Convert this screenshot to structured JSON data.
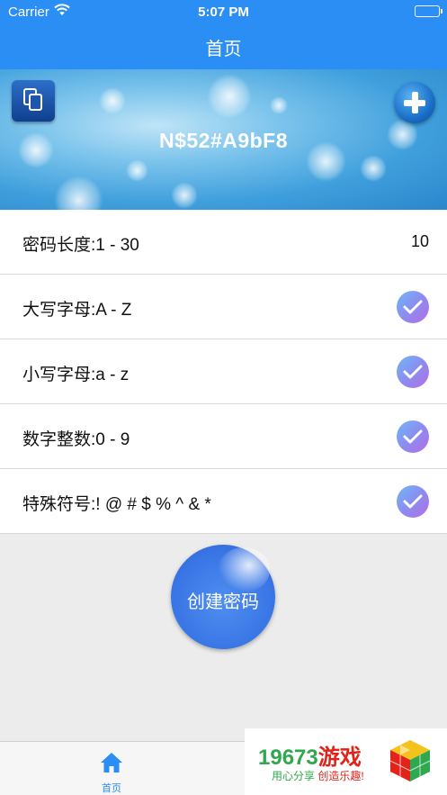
{
  "status_bar": {
    "carrier": "Carrier",
    "time": "5:07 PM"
  },
  "nav": {
    "title": "首页"
  },
  "banner": {
    "password": "N$52#A9bF8"
  },
  "settings": {
    "length_label": "密码长度:1 - 30",
    "length_value": "10",
    "uppercase_label": "大写字母:A - Z",
    "lowercase_label": "小写字母:a - z",
    "digits_label": "数字整数:0 - 9",
    "symbols_label": "特殊符号:! @ # $ % ^ & *"
  },
  "actions": {
    "create_label": "创建密码"
  },
  "tabbar": {
    "home_label": "首页"
  },
  "ad": {
    "brand_num": "19673",
    "brand_cn": "游戏",
    "slogan_a": "用心分享",
    "slogan_b": "创造乐趣!"
  },
  "colors": {
    "primary": "#2a8ef5",
    "check_gradient_start": "#6fb9f5",
    "check_gradient_end": "#b26fe6",
    "create_button": "#3a77e6"
  },
  "icons": {
    "copy": "copy-icon",
    "add": "plus-icon",
    "check": "checkmark-icon",
    "home": "home-icon",
    "wifi": "wifi-icon",
    "battery": "battery-icon"
  }
}
